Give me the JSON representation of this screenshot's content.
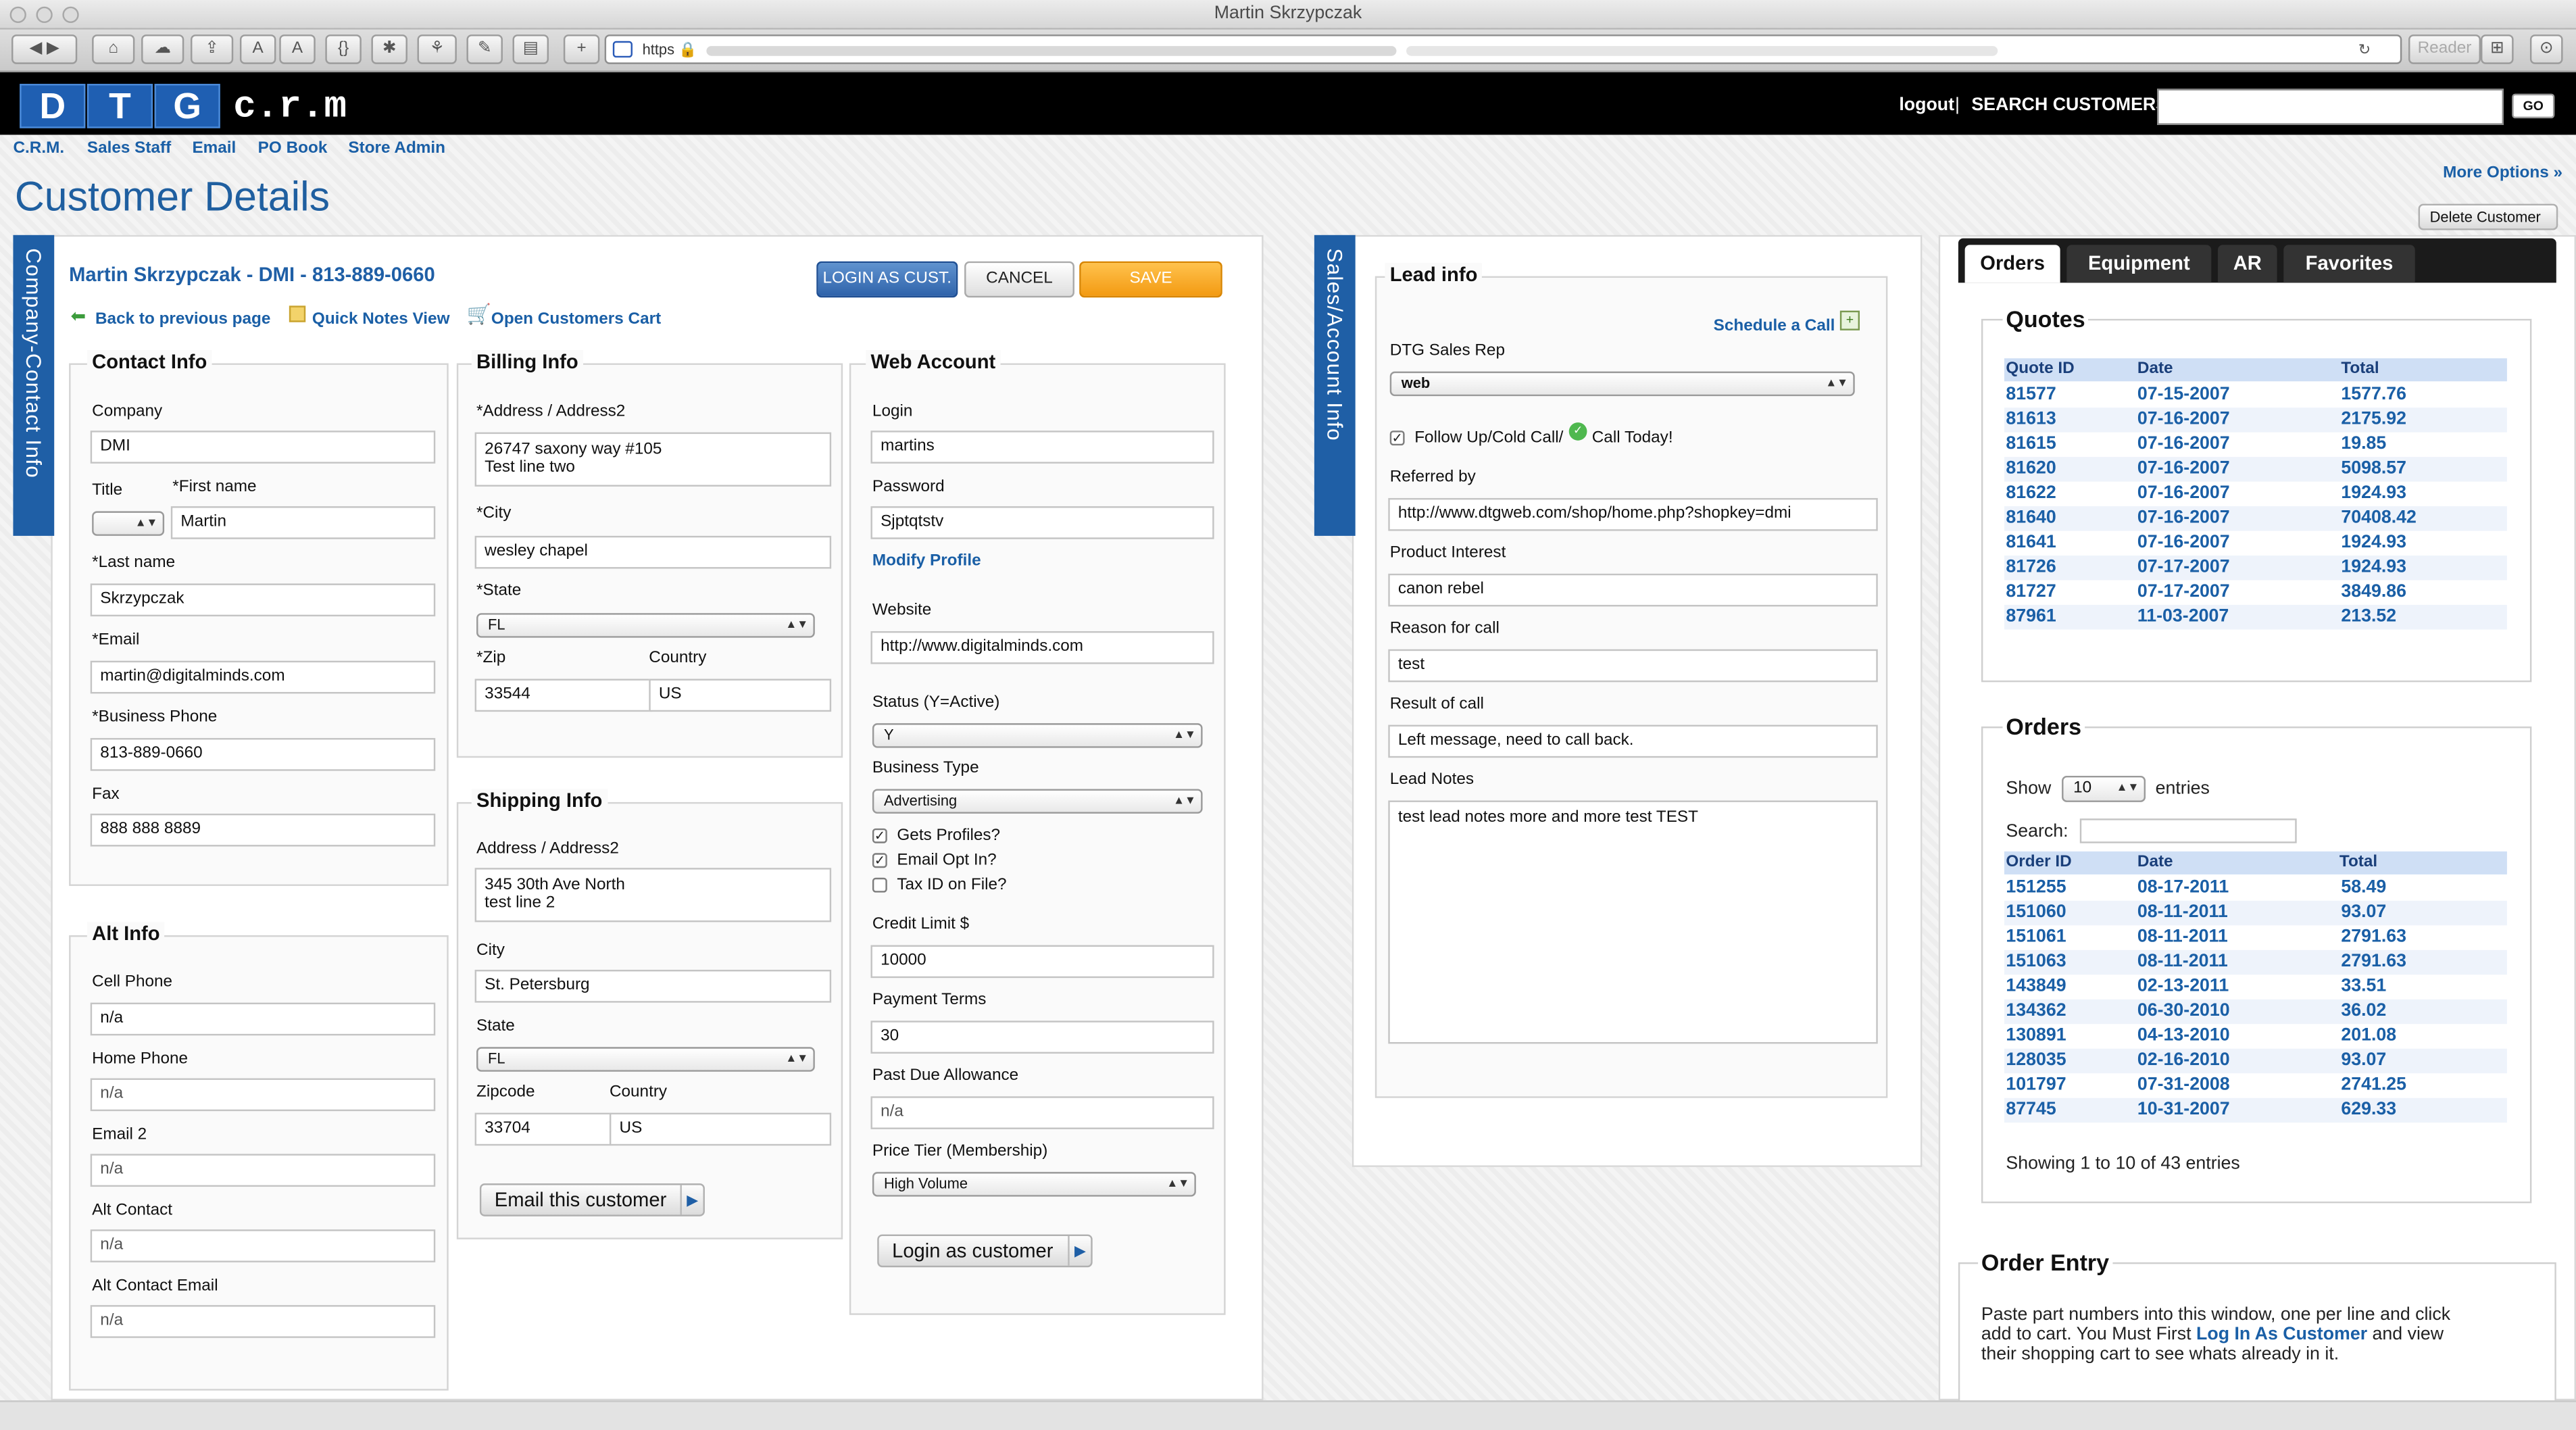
{
  "window": {
    "title": "Martin Skrzypczak"
  },
  "browser": {
    "url_prefix": "https",
    "reader": "Reader"
  },
  "header": {
    "logo_letters": [
      "D",
      "T",
      "G"
    ],
    "logo_suffix": "c.r.m",
    "logout": "logout",
    "separator": "|",
    "search_label": "SEARCH CUSTOMERS",
    "go": "GO"
  },
  "nav": {
    "items": [
      "C.R.M.",
      "Sales Staff",
      "Email",
      "PO Book",
      "Store Admin"
    ],
    "more_options": "More Options »"
  },
  "page": {
    "title": "Customer Details",
    "delete_button": "Delete Customer"
  },
  "customer": {
    "vertical_tab": "Company-Contact Info",
    "heading": "Martin Skrzypczak - DMI - 813-889-0660",
    "buttons": {
      "login": "LOGIN AS CUST.",
      "cancel": "CANCEL",
      "save": "SAVE CUSTOMER"
    },
    "links": {
      "back": "Back to previous page",
      "quick_notes": "Quick Notes View",
      "open_cart": "Open Customers Cart"
    },
    "contact": {
      "legend": "Contact Info",
      "company_label": "Company",
      "company": "DMI",
      "title_label": "Title",
      "first_label": "*First name",
      "first": "Martin",
      "last_label": "*Last name",
      "last": "Skrzypczak",
      "email_label": "*Email",
      "email": "martin@digitalminds.com",
      "phone_label": "*Business Phone",
      "phone": "813-889-0660",
      "fax_label": "Fax",
      "fax": "888 888 8889"
    },
    "alt": {
      "legend": "Alt Info",
      "cell_label": "Cell Phone",
      "cell": "n/a",
      "home_label": "Home Phone",
      "home": "n/a",
      "email2_label": "Email 2",
      "email2": "n/a",
      "altc_label": "Alt Contact",
      "altc": "n/a",
      "altce_label": "Alt Contact Email",
      "altce": "n/a"
    },
    "billing": {
      "legend": "Billing Info",
      "addr_label": "*Address / Address2",
      "addr": "26747 saxony way #105\nTest line two",
      "city_label": "*City",
      "city": "wesley chapel",
      "state_label": "*State",
      "state": "FL",
      "zip_label": "*Zip",
      "zip": "33544",
      "country_label": "Country",
      "country": "US"
    },
    "shipping": {
      "legend": "Shipping Info",
      "addr_label": "Address / Address2",
      "addr": "345 30th Ave North\ntest line 2",
      "city_label": "City",
      "city": "St. Petersburg",
      "state_label": "State",
      "state": "FL",
      "zip_label": "Zipcode",
      "zip": "33704",
      "country_label": "Country",
      "country": "US",
      "email_button": "Email this customer"
    },
    "web": {
      "legend": "Web Account",
      "login_label": "Login",
      "login": "martins",
      "password_label": "Password",
      "password": "Sjptqtstv",
      "modify": "Modify Profile",
      "website_label": "Website",
      "website": "http://www.digitalminds.com",
      "status_label": "Status (Y=Active)",
      "status": "Y",
      "btype_label": "Business Type",
      "btype": "Advertising",
      "gets_profiles": "Gets Profiles?",
      "email_opt": "Email Opt In?",
      "tax_id": "Tax ID on File?",
      "credit_label": "Credit Limit $",
      "credit": "10000",
      "terms_label": "Payment Terms",
      "terms": "30",
      "pastdue_label": "Past Due Allowance",
      "pastdue": "n/a",
      "tier_label": "Price Tier (Membership)",
      "tier": "High Volume",
      "login_button": "Login as customer"
    }
  },
  "sales": {
    "vertical_tab": "Sales/Account Info",
    "legend": "Lead info",
    "schedule": "Schedule a Call",
    "rep_label": "DTG Sales Rep",
    "rep": "web",
    "follow_up": "Follow Up/Cold Call/",
    "call_today": "Call Today!",
    "referred_label": "Referred by",
    "referred": "http://www.dtgweb.com/shop/home.php?shopkey=dmi",
    "interest_label": "Product Interest",
    "interest": "canon rebel",
    "reason_label": "Reason for call",
    "reason": "test",
    "result_label": "Result of call",
    "result": "Left message, need to call back.",
    "notes_label": "Lead Notes",
    "notes": "test lead notes more and more test TEST"
  },
  "right": {
    "tabs": [
      "Orders",
      "Equipment",
      "AR",
      "Favorites"
    ],
    "quotes": {
      "title": "Quotes",
      "headers": [
        "Quote ID",
        "Date",
        "Total"
      ],
      "rows": [
        [
          "81577",
          "07-15-2007",
          "1577.76"
        ],
        [
          "81613",
          "07-16-2007",
          "2175.92"
        ],
        [
          "81615",
          "07-16-2007",
          "19.85"
        ],
        [
          "81620",
          "07-16-2007",
          "5098.57"
        ],
        [
          "81622",
          "07-16-2007",
          "1924.93"
        ],
        [
          "81640",
          "07-16-2007",
          "70408.42"
        ],
        [
          "81641",
          "07-16-2007",
          "1924.93"
        ],
        [
          "81726",
          "07-17-2007",
          "1924.93"
        ],
        [
          "81727",
          "07-17-2007",
          "3849.86"
        ],
        [
          "87961",
          "11-03-2007",
          "213.52"
        ]
      ]
    },
    "orders": {
      "title": "Orders",
      "show": "Show",
      "entries_value": "10",
      "entries": "entries",
      "search": "Search:",
      "headers": [
        "Order ID",
        "Date",
        "Total"
      ],
      "rows": [
        [
          "151255",
          "08-17-2011",
          "58.49"
        ],
        [
          "151060",
          "08-11-2011",
          "93.07"
        ],
        [
          "151061",
          "08-11-2011",
          "2791.63"
        ],
        [
          "151063",
          "08-11-2011",
          "2791.63"
        ],
        [
          "143849",
          "02-13-2011",
          "33.51"
        ],
        [
          "134362",
          "06-30-2010",
          "36.02"
        ],
        [
          "130891",
          "04-13-2010",
          "201.08"
        ],
        [
          "128035",
          "02-16-2010",
          "93.07"
        ],
        [
          "101797",
          "07-31-2008",
          "2741.25"
        ],
        [
          "87745",
          "10-31-2007",
          "629.33"
        ]
      ],
      "showing": "Showing 1 to 10 of 43 entries"
    },
    "order_entry": {
      "title": "Order Entry",
      "text1": "Paste part numbers into this window, one per line and click",
      "text2a": "add to cart. You Must First ",
      "text2link": "Log In As Customer",
      "text2b": " and view",
      "text3": "their shopping cart to see whats already in it."
    }
  }
}
